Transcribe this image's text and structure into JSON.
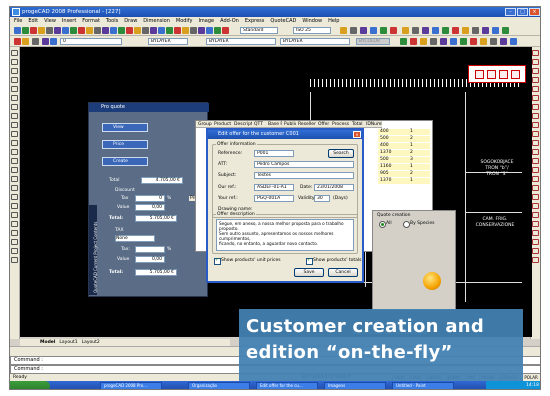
{
  "window": {
    "title": "progeCAD 2008 Professional - [227]"
  },
  "menu": [
    "File",
    "Edit",
    "View",
    "Insert",
    "Format",
    "Tools",
    "Draw",
    "Dimension",
    "Modify",
    "Image",
    "Add-On",
    "Express",
    "QuoteCAD",
    "Window",
    "Help"
  ],
  "toolbar": {
    "style_combo": "Standard",
    "iso_combo": "ISO 25",
    "layer_combo": "0",
    "linetype1": "BYLAYER",
    "linetype2": "BYLAYER",
    "linetype3": "BYLAYER",
    "color_combo": "BYCOLOR"
  },
  "cad": {
    "texts": [
      "SOGOKOBJACE\nTRON “b”/\nTRON “S”",
      "CAM. FRIG.\nCONSERVAZIONE",
      "PREPARAZIONE ALLA DISTRIBUZIONE"
    ]
  },
  "proquote": {
    "title": "Pro quote",
    "buttons": [
      "View",
      "Price",
      "Create"
    ],
    "total_label": "Total",
    "total_value": "4.705,00 €",
    "discount_label": "Discount",
    "tax_label": "Tax",
    "tax_value": "0",
    "tax_unit": "%",
    "value_label": "Value",
    "value_value": "0,00",
    "total2_label": "Total:",
    "total2_value": "5.705,00 €",
    "tax_section": "TAX",
    "tax_select": "None",
    "tax2_label": "Tax:",
    "tax2_unit": "%",
    "value2_label": "Value",
    "value2_value": "0,00",
    "total3_label": "Total:",
    "total3_value": "5.705,00 €",
    "side_text": "QuoteCAD Current Project Contents",
    "product_tab": "Product"
  },
  "grid": {
    "headers": [
      "Group",
      "Product",
      "Descripti",
      "QTT",
      "Base Pr",
      "Public",
      "Reseller",
      "Offer",
      "Process",
      "Total",
      "IDNumb"
    ],
    "rows": [
      [
        "400",
        "1"
      ],
      [
        "500",
        "2"
      ],
      [
        "400",
        "1"
      ],
      [
        "1370",
        "2"
      ],
      [
        "500",
        "3"
      ],
      [
        "1160",
        "1"
      ],
      [
        "905",
        "2"
      ],
      [
        "1370",
        "1"
      ]
    ]
  },
  "dialog": {
    "title": "Edit offer for the customer C001",
    "offer_info_legend": "Offer information",
    "reference_label": "Reference:",
    "reference_value": "P001",
    "search_button": "Search",
    "att_label": "ATT:",
    "att_value": "Pedro Campos",
    "subject_label": "Subject:",
    "subject_value": "Testes",
    "our_ref_label": "Our ref.:",
    "our_ref_value": "ASDEF-01-A1",
    "date_label": "Date:",
    "date_value": "23/01/2008",
    "your_ref_label": "Your ref.:",
    "your_ref_value": "PGQ-001A",
    "validity_label": "Validity:",
    "validity_value": "30",
    "validity_unit": "(Days)",
    "drawing_label": "Drawing name:",
    "offer_desc_legend": "Offer description",
    "description": "Segue, em anexo, a nossa melhor proposta para o trabalho proposto.\nSem outro assunto, apresentamos os nossos melhores cumprimentos,\nficando, no entanto, a aguardar novo contacto.",
    "show_prices": "Show products' unit prices",
    "show_totals": "Show products' totals",
    "save_button": "Save",
    "cancel_button": "Cancel"
  },
  "quote_creation": {
    "legend": "Quote creation",
    "option_all": "All",
    "option_by_species": "By Species"
  },
  "overlay": {
    "line1": "Customer creation and",
    "line2": "edition “on-the-fly”"
  },
  "layout_tabs": [
    "Model",
    "Layout1",
    "Layout2"
  ],
  "command": {
    "line1": "Command :",
    "line2": "Command :"
  },
  "status": {
    "ready": "Ready",
    "coords": "817.3065,472.5624,0",
    "buttons": [
      "SNAP",
      "GRID",
      "ORTHO",
      "ESNAP",
      "LWT",
      "MODEL",
      "ETRACK",
      "POLAR"
    ]
  },
  "taskbar": {
    "start": "start",
    "tasks": [
      "progeCAD 2008 Pro...",
      "Organização",
      "Edit offer for the cu...",
      "Imagens",
      "Untitled - Paint"
    ],
    "clock": "14:18"
  },
  "colors": {
    "accent": "#1d4fb0",
    "overlay": "#4281b2",
    "grid_row": "#fff7c0"
  }
}
